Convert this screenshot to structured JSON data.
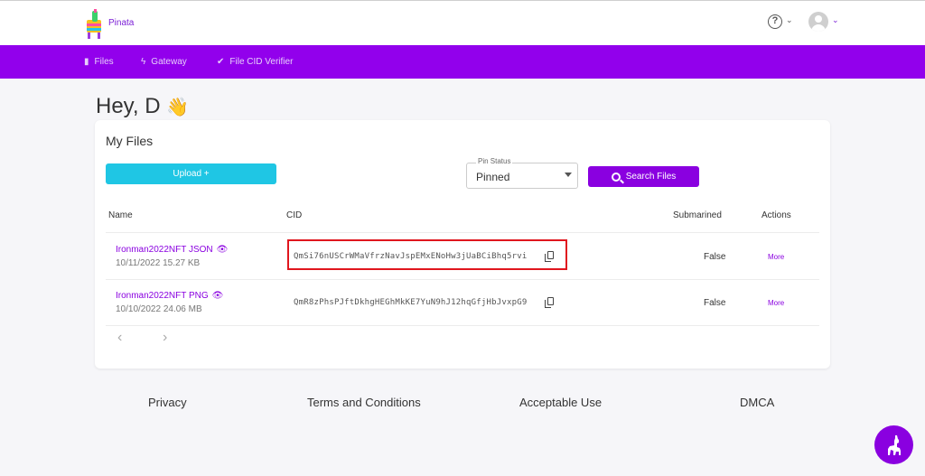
{
  "app": {
    "brand": "Pinata"
  },
  "header": {
    "help_icon": "question-circle-icon",
    "help_chevron": "⌄",
    "avatar_chevron": "⌄"
  },
  "nav": {
    "items": [
      {
        "label": "Files",
        "icon": "file-icon",
        "glyph": "▮"
      },
      {
        "label": "Gateway",
        "icon": "lightning-icon",
        "glyph": "ϟ"
      },
      {
        "label": "File CID Verifier",
        "icon": "double-check-icon",
        "glyph": "✔"
      }
    ]
  },
  "main": {
    "greeting": "Hey, D",
    "greeting_emoji": "👋",
    "card_title": "My Files",
    "upload_label": "Upload +",
    "pin_status": {
      "label": "Pin Status",
      "value": "Pinned"
    },
    "search_label": "Search Files",
    "columns": {
      "name": "Name",
      "cid": "CID",
      "submarined": "Submarined",
      "actions": "Actions"
    },
    "files": [
      {
        "name": "Ironman2022NFT JSON",
        "date_size": "10/11/2022 15.27 KB",
        "cid": "QmSi76nUSCrWMaVfrzNavJspEMxENoHw3jUaBCiBhq5rvi",
        "submarined": "False",
        "action": "More"
      },
      {
        "name": "Ironman2022NFT PNG",
        "date_size": "10/10/2022 24.06 MB",
        "cid": "QmR8zPhsPJftDkhgHEGhMkKE7YuN9hJ12hqGfjHbJvxpG9",
        "submarined": "False",
        "action": "More"
      }
    ],
    "pager": {
      "prev": "‹",
      "next": "›"
    }
  },
  "footer": {
    "links": [
      "Privacy",
      "Terms and Conditions",
      "Acceptable Use",
      "DMCA"
    ]
  },
  "colors": {
    "accent": "#8a00e0",
    "navbar": "#9200ec",
    "upload": "#1fc6e4",
    "highlight": "#e0161e"
  }
}
